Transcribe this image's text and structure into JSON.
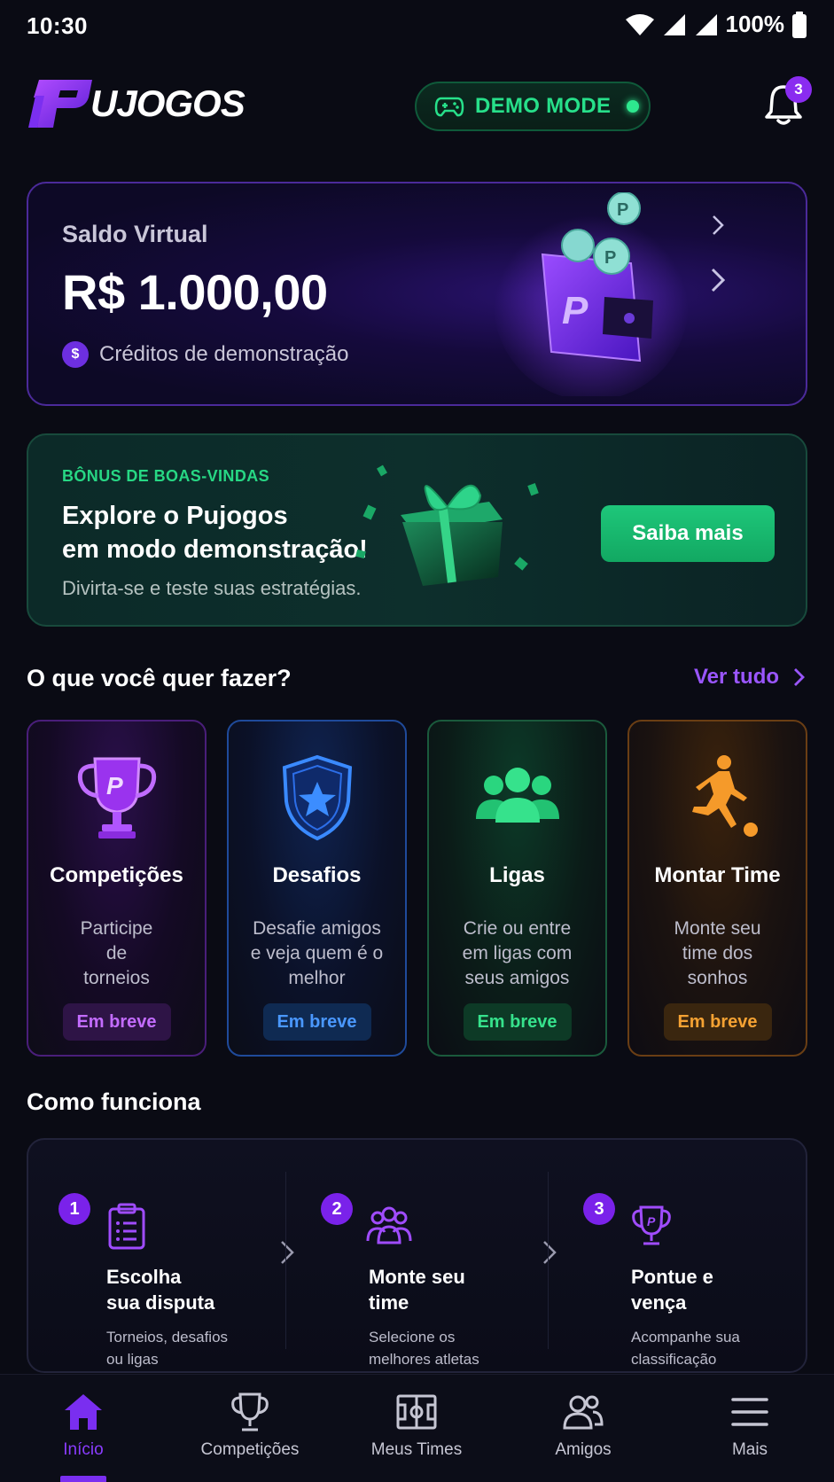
{
  "status_bar": {
    "time": "10:30",
    "battery": "100%"
  },
  "header": {
    "logo_text": "UJOGOS",
    "demo_label": "DEMO MODE",
    "notifications": "3"
  },
  "balance": {
    "label": "Saldo Virtual",
    "value": "R$ 1.000,00",
    "subtitle": "Créditos de demonstração",
    "coin_symbol": "$"
  },
  "bonus": {
    "kicker": "BÔNUS DE BOAS-VINDAS",
    "title_line1": "Explore o Pujogos",
    "title_line2": "em modo demonstração!",
    "subtitle": "Divirta-se e teste suas estratégias.",
    "button": "Saiba mais"
  },
  "features_section": {
    "title": "O que você quer fazer?",
    "see_all": "Ver tudo"
  },
  "features": [
    {
      "title": "Competições",
      "desc": "Participe de torneios",
      "badge": "Em breve",
      "icon": "trophy-icon",
      "color": "#a13cf2"
    },
    {
      "title": "Desafios",
      "desc": "Desafie amigos e veja quem é o melhor",
      "badge": "Em breve",
      "icon": "shield-star-icon",
      "color": "#2f7bf5"
    },
    {
      "title": "Ligas",
      "desc": "Crie ou entre em ligas com seus amigos",
      "badge": "Em breve",
      "icon": "group-icon",
      "color": "#2ad67f"
    },
    {
      "title": "Montar Time",
      "desc": "Monte seu time dos sonhos",
      "badge": "Em breve",
      "icon": "player-kick-icon",
      "color": "#f59a2a"
    }
  ],
  "how_section": {
    "title": "Como funciona"
  },
  "steps": [
    {
      "num": "1",
      "title_line1": "Escolha",
      "title_line2": "sua disputa",
      "desc_line1": "Torneios, desafios",
      "desc_line2": "ou ligas",
      "icon": "clipboard-icon"
    },
    {
      "num": "2",
      "title_line1": "Monte seu",
      "title_line2": "time",
      "desc_line1": "Selecione os",
      "desc_line2": "melhores atletas",
      "icon": "team-icon"
    },
    {
      "num": "3",
      "title_line1": "Pontue e",
      "title_line2": "vença",
      "desc_line1": "Acompanhe sua",
      "desc_line2": "classificação",
      "icon": "trophy-icon"
    }
  ],
  "bottom_nav": [
    {
      "label": "Início",
      "icon": "home-icon",
      "active": true
    },
    {
      "label": "Competições",
      "icon": "trophy-icon",
      "active": false
    },
    {
      "label": "Meus Times",
      "icon": "field-icon",
      "active": false
    },
    {
      "label": "Amigos",
      "icon": "friends-icon",
      "active": false
    },
    {
      "label": "Mais",
      "icon": "menu-icon",
      "active": false
    }
  ],
  "colors": {
    "accent": "#7a2ef0",
    "green": "#27e08a",
    "background": "#0a0b14"
  }
}
